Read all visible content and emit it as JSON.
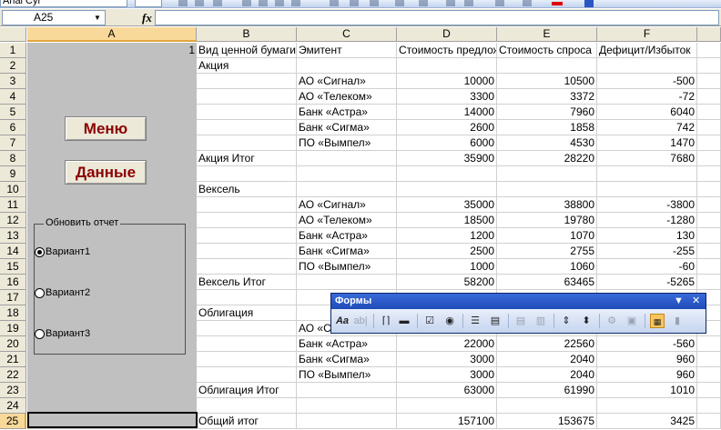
{
  "toolbar": {
    "font_name": "Arial Cyr"
  },
  "formula_bar": {
    "name_box": "A25",
    "fx_label": "fx",
    "formula": ""
  },
  "columns": [
    "A",
    "B",
    "C",
    "D",
    "E",
    "F"
  ],
  "active": {
    "col": "A",
    "row": 25
  },
  "cells": {
    "A1": "1",
    "header": [
      "Вид ценной бумаги",
      "Эмитент",
      "Стоимость предложения",
      "Стоимость спроса",
      "Дефицит/Избыток"
    ]
  },
  "rows": [
    {
      "n": "1",
      "b": "Вид ценной бумаги",
      "c": "Эмитент",
      "d": "Стоимость предложения",
      "e": "Стоимость спроса",
      "f": "Дефицит/Избыток",
      "hdr": true
    },
    {
      "n": "2",
      "b": "Акция",
      "c": "",
      "d": "",
      "e": "",
      "f": ""
    },
    {
      "n": "3",
      "b": "",
      "c": "АО «Сигнал»",
      "d": "10000",
      "e": "10500",
      "f": "-500"
    },
    {
      "n": "4",
      "b": "",
      "c": "АО «Телеком»",
      "d": "3300",
      "e": "3372",
      "f": "-72"
    },
    {
      "n": "5",
      "b": "",
      "c": "Банк «Астра»",
      "d": "14000",
      "e": "7960",
      "f": "6040"
    },
    {
      "n": "6",
      "b": "",
      "c": "Банк «Сигма»",
      "d": "2600",
      "e": "1858",
      "f": "742"
    },
    {
      "n": "7",
      "b": "",
      "c": "ПО «Вымпел»",
      "d": "6000",
      "e": "4530",
      "f": "1470"
    },
    {
      "n": "8",
      "b": "Акция Итог",
      "c": "",
      "d": "35900",
      "e": "28220",
      "f": "7680"
    },
    {
      "n": "9",
      "b": "",
      "c": "",
      "d": "",
      "e": "",
      "f": ""
    },
    {
      "n": "10",
      "b": "Вексель",
      "c": "",
      "d": "",
      "e": "",
      "f": ""
    },
    {
      "n": "11",
      "b": "",
      "c": "АО «Сигнал»",
      "d": "35000",
      "e": "38800",
      "f": "-3800"
    },
    {
      "n": "12",
      "b": "",
      "c": "АО «Телеком»",
      "d": "18500",
      "e": "19780",
      "f": "-1280"
    },
    {
      "n": "13",
      "b": "",
      "c": "Банк «Астра»",
      "d": "1200",
      "e": "1070",
      "f": "130"
    },
    {
      "n": "14",
      "b": "",
      "c": "Банк «Сигма»",
      "d": "2500",
      "e": "2755",
      "f": "-255"
    },
    {
      "n": "15",
      "b": "",
      "c": "ПО «Вымпел»",
      "d": "1000",
      "e": "1060",
      "f": "-60"
    },
    {
      "n": "16",
      "b": "Вексель Итог",
      "c": "",
      "d": "58200",
      "e": "63465",
      "f": "-5265"
    },
    {
      "n": "17",
      "b": "",
      "c": "",
      "d": "",
      "e": "",
      "f": ""
    },
    {
      "n": "18",
      "b": "Облигация",
      "c": "",
      "d": "",
      "e": "",
      "f": ""
    },
    {
      "n": "19",
      "b": "",
      "c": "АО «С",
      "d": "",
      "e": "",
      "f": ""
    },
    {
      "n": "20",
      "b": "",
      "c": "Банк «Астра»",
      "d": "22000",
      "e": "22560",
      "f": "-560"
    },
    {
      "n": "21",
      "b": "",
      "c": "Банк «Сигма»",
      "d": "3000",
      "e": "2040",
      "f": "960"
    },
    {
      "n": "22",
      "b": "",
      "c": "ПО «Вымпел»",
      "d": "3000",
      "e": "2040",
      "f": "960"
    },
    {
      "n": "23",
      "b": "Облигация Итог",
      "c": "",
      "d": "63000",
      "e": "61990",
      "f": "1010"
    },
    {
      "n": "24",
      "b": "",
      "c": "",
      "d": "",
      "e": "",
      "f": ""
    },
    {
      "n": "25",
      "b": "Общий итог",
      "c": "",
      "d": "157100",
      "e": "153675",
      "f": "3425"
    }
  ],
  "buttons": {
    "menu": "Меню",
    "data": "Данные"
  },
  "report_group": {
    "title": "Обновить отчет",
    "options": [
      {
        "label": "Вариант1",
        "checked": true
      },
      {
        "label": "Вариант2",
        "checked": false
      },
      {
        "label": "Вариант3",
        "checked": false
      }
    ]
  },
  "forms_toolbar": {
    "title": "Формы",
    "items": [
      "label-icon",
      "edit-box-icon",
      "group-box-icon",
      "button-icon",
      "checkbox-icon",
      "option-button-icon",
      "list-box-icon",
      "combo-box-icon",
      "combo-list-edit-icon",
      "combo-dropdown-edit-icon",
      "scroll-bar-icon",
      "spinner-icon",
      "control-properties-icon",
      "edit-code-icon",
      "toggle-grid-icon",
      "run-dialog-icon"
    ]
  }
}
